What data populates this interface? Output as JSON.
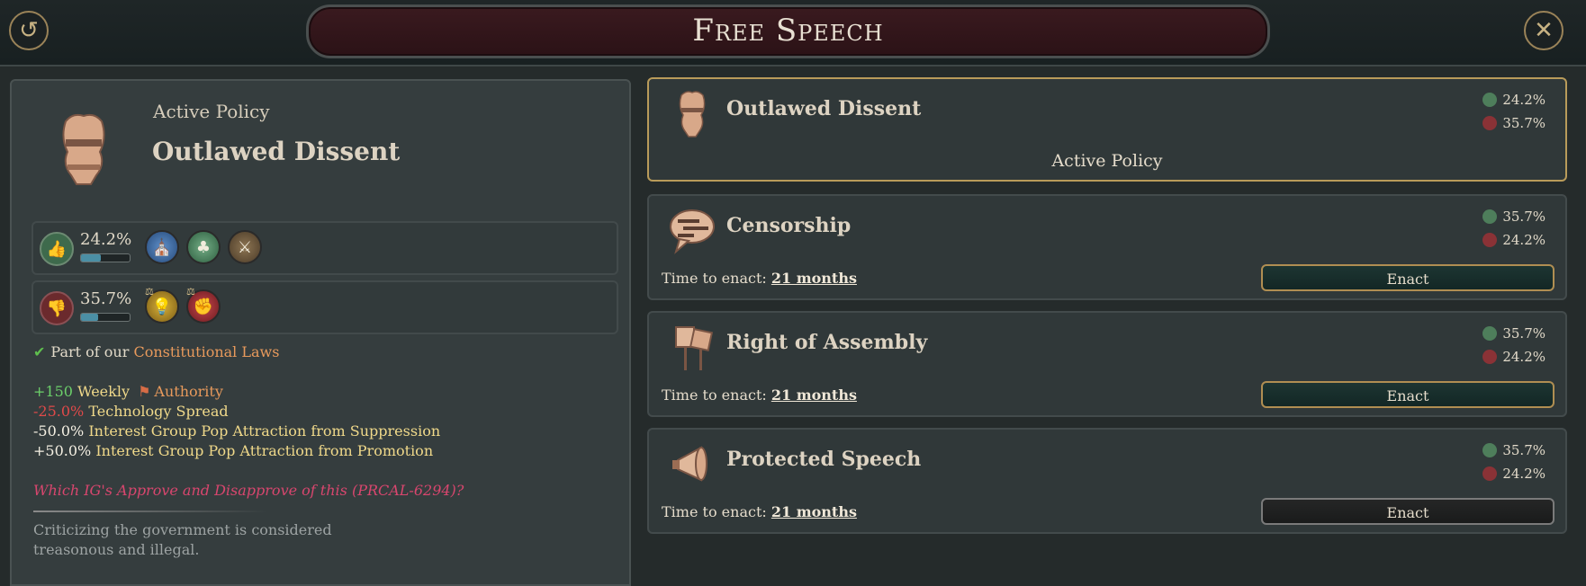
{
  "header": {
    "title": "Free Speech",
    "back_icon": "back-icon",
    "close_icon": "close-icon"
  },
  "left_panel": {
    "kicker": "Active Policy",
    "name": "Outlawed Dissent",
    "approve": {
      "percent": "24.2%",
      "bar_fill": 0.4,
      "groups": [
        "Devout",
        "Rural Folk",
        "Armed Forces"
      ]
    },
    "disapprove": {
      "percent": "35.7%",
      "bar_fill": 0.35,
      "groups": [
        "Intelligentsia",
        "Trade Unions"
      ]
    },
    "constitutional": {
      "prefix": "Part of our",
      "link": "Constitutional Laws"
    },
    "effects": [
      {
        "value": "+150",
        "text": "Weekly",
        "resource": "Authority"
      },
      {
        "value": "-25.0%",
        "text": "Technology Spread"
      },
      {
        "value": "-50.0%",
        "text": "Interest Group Pop Attraction from Suppression"
      },
      {
        "value": "+50.0%",
        "text": "Interest Group Pop Attraction from Promotion"
      }
    ],
    "ig_question": "Which IG's Approve and Disapprove of this (PRCAL-6294)?",
    "description": "Criticizing the government is considered treasonous and illegal."
  },
  "policies": [
    {
      "name": "Outlawed Dissent",
      "approve": "24.2%",
      "disapprove": "35.7%",
      "status": "Active Policy"
    },
    {
      "name": "Censorship",
      "approve": "35.7%",
      "disapprove": "24.2%",
      "time_label": "Time to enact:",
      "time_value": "21 months",
      "button": "Enact"
    },
    {
      "name": "Right of Assembly",
      "approve": "35.7%",
      "disapprove": "24.2%",
      "time_label": "Time to enact:",
      "time_value": "21 months",
      "button": "Enact"
    },
    {
      "name": "Protected Speech",
      "approve": "35.7%",
      "disapprove": "24.2%",
      "time_label": "Time to enact:",
      "time_value": "21 months",
      "button": "Enact"
    }
  ],
  "colors": {
    "background": "#252b2b",
    "title_plate": "#3a1a1f",
    "gold_border": "#b99b5a",
    "approve": "#4e7e5b",
    "disapprove": "#8a3236",
    "link_orange": "#e89a5c",
    "question_pink": "#d8466e"
  }
}
